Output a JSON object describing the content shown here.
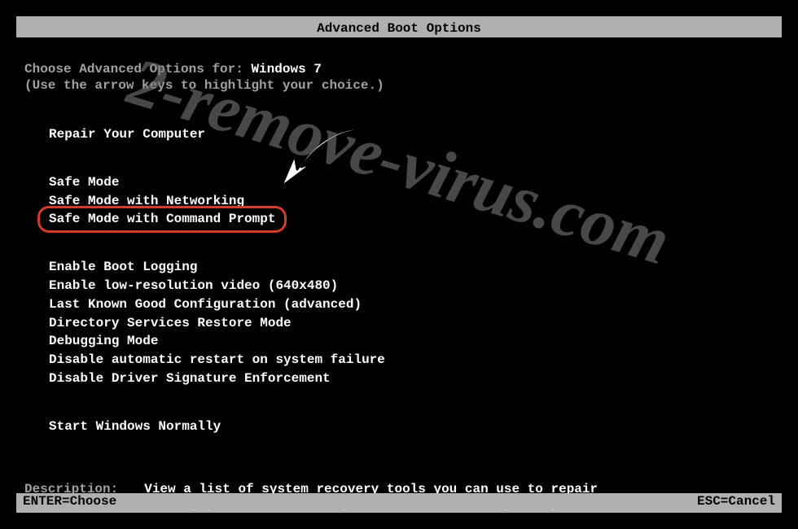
{
  "title": "Advanced Boot Options",
  "prompt": {
    "prefix": "Choose Advanced Options for: ",
    "os": "Windows 7"
  },
  "hint": "(Use the arrow keys to highlight your choice.)",
  "groups": [
    {
      "items": [
        "Repair Your Computer"
      ]
    },
    {
      "items": [
        "Safe Mode",
        "Safe Mode with Networking",
        "Safe Mode with Command Prompt"
      ],
      "highlightIndex": 2
    },
    {
      "items": [
        "Enable Boot Logging",
        "Enable low-resolution video (640x480)",
        "Last Known Good Configuration (advanced)",
        "Directory Services Restore Mode",
        "Debugging Mode",
        "Disable automatic restart on system failure",
        "Disable Driver Signature Enforcement"
      ]
    },
    {
      "items": [
        "Start Windows Normally"
      ]
    }
  ],
  "description": {
    "label": "Description:",
    "text": "View a list of system recovery tools you can use to repair startup problems, run diagnostics, or restore your system."
  },
  "footer": {
    "left": "ENTER=Choose",
    "right": "ESC=Cancel"
  },
  "watermark": "2-remove-virus.com"
}
